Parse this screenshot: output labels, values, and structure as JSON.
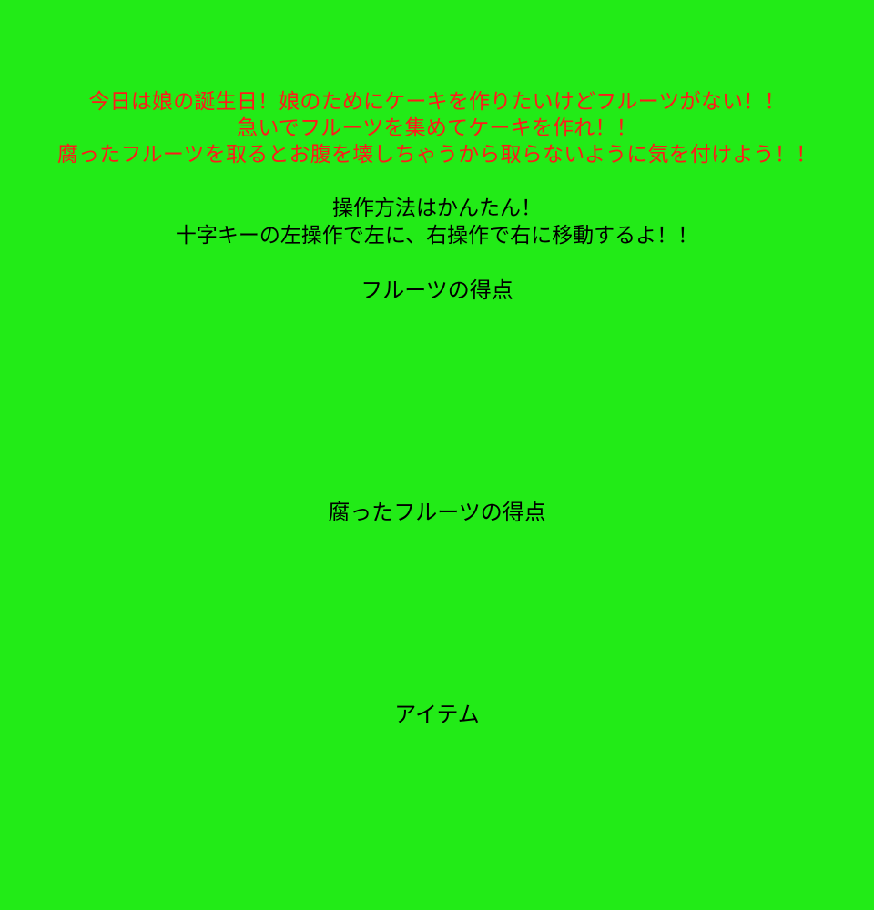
{
  "intro": {
    "story_lines": [
      "今日は娘の誕生日！娘のためにケーキを作りたいけどフルーツがない！！",
      "急いでフルーツを集めてケーキを作れ！！",
      "腐ったフルーツを取るとお腹を壊しちゃうから取らないように気を付けよう！！"
    ],
    "howto_lines": [
      "操作方法はかんたん！",
      "十字キーの左操作で左に、右操作で右に移動するよ！！"
    ]
  },
  "sections": {
    "fruit_heading": "フルーツの得点",
    "rotten_heading": "腐ったフルーツの得点",
    "item_heading": "アイテム"
  },
  "colors": {
    "background": "#22eb17",
    "story_text": "#ff1a1a",
    "body_text": "#000000"
  }
}
